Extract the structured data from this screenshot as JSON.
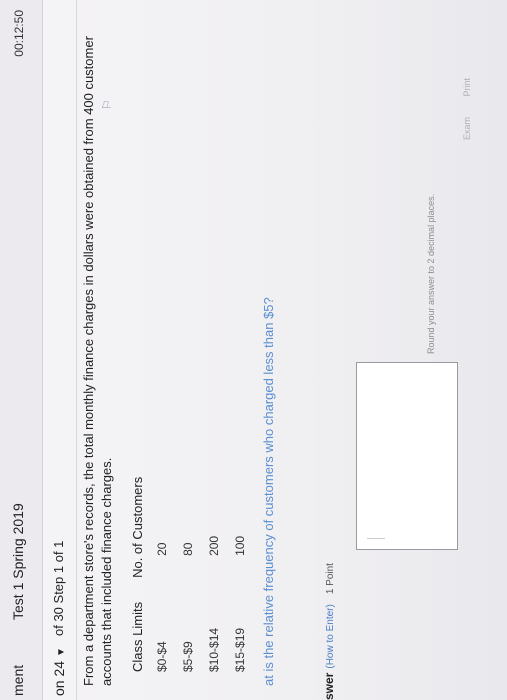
{
  "header": {
    "crumb": "ment",
    "test_title": "Test 1 Spring 2019",
    "timer": "00:12:50"
  },
  "question_bar": {
    "selector": "on 24",
    "step": "of 30 Step 1 of 1"
  },
  "problem": {
    "prompt": "From a department store's records, the total monthly finance charges in dollars were obtained from 400 customer accounts that included finance charges.",
    "table": {
      "headers": [
        "Class Limits",
        "No. of Customers"
      ],
      "rows": [
        [
          "$0-$4",
          "20"
        ],
        [
          "$5-$9",
          "80"
        ],
        [
          "$10-$14",
          "200"
        ],
        [
          "$15-$19",
          "100"
        ]
      ]
    },
    "question": "at is the relative frequency of customers who charged less than $5?"
  },
  "answer": {
    "label": "swer",
    "howto": "(How to Enter)",
    "points": "1 Point",
    "hint": "Round your answer to 2 decimal places."
  },
  "footer": {
    "items": [
      "Exam",
      "Print"
    ]
  },
  "icons": {
    "flag": "flag-icon",
    "caret": "caret-down-icon"
  }
}
